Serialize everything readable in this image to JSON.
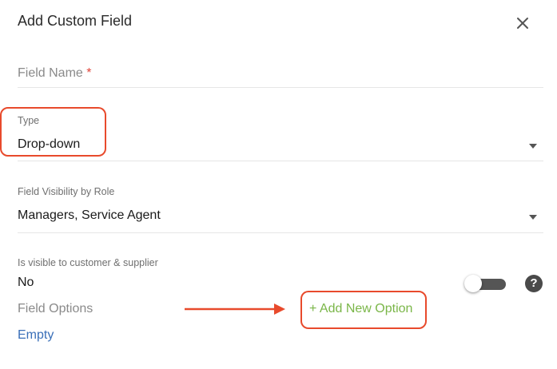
{
  "dialog": {
    "title": "Add Custom Field",
    "close_icon": "close-icon"
  },
  "fields": {
    "field_name": {
      "label": "Field Name",
      "required_marker": "*",
      "value": ""
    },
    "type": {
      "label": "Type",
      "value": "Drop-down"
    },
    "visibility": {
      "label": "Field Visibility by Role",
      "value": "Managers, Service Agent"
    },
    "customer_supplier": {
      "label": "Is visible to customer & supplier",
      "value": "No",
      "toggle_on": false
    },
    "options": {
      "label": "Field Options",
      "add_label": "+ Add New Option",
      "empty_label": "Empty"
    }
  },
  "icons": {
    "help": "?",
    "dropdown": "caret-down-icon"
  },
  "colors": {
    "annotation": "#e84a2c",
    "add_option": "#7ab648",
    "empty_link": "#3a6fb8"
  }
}
